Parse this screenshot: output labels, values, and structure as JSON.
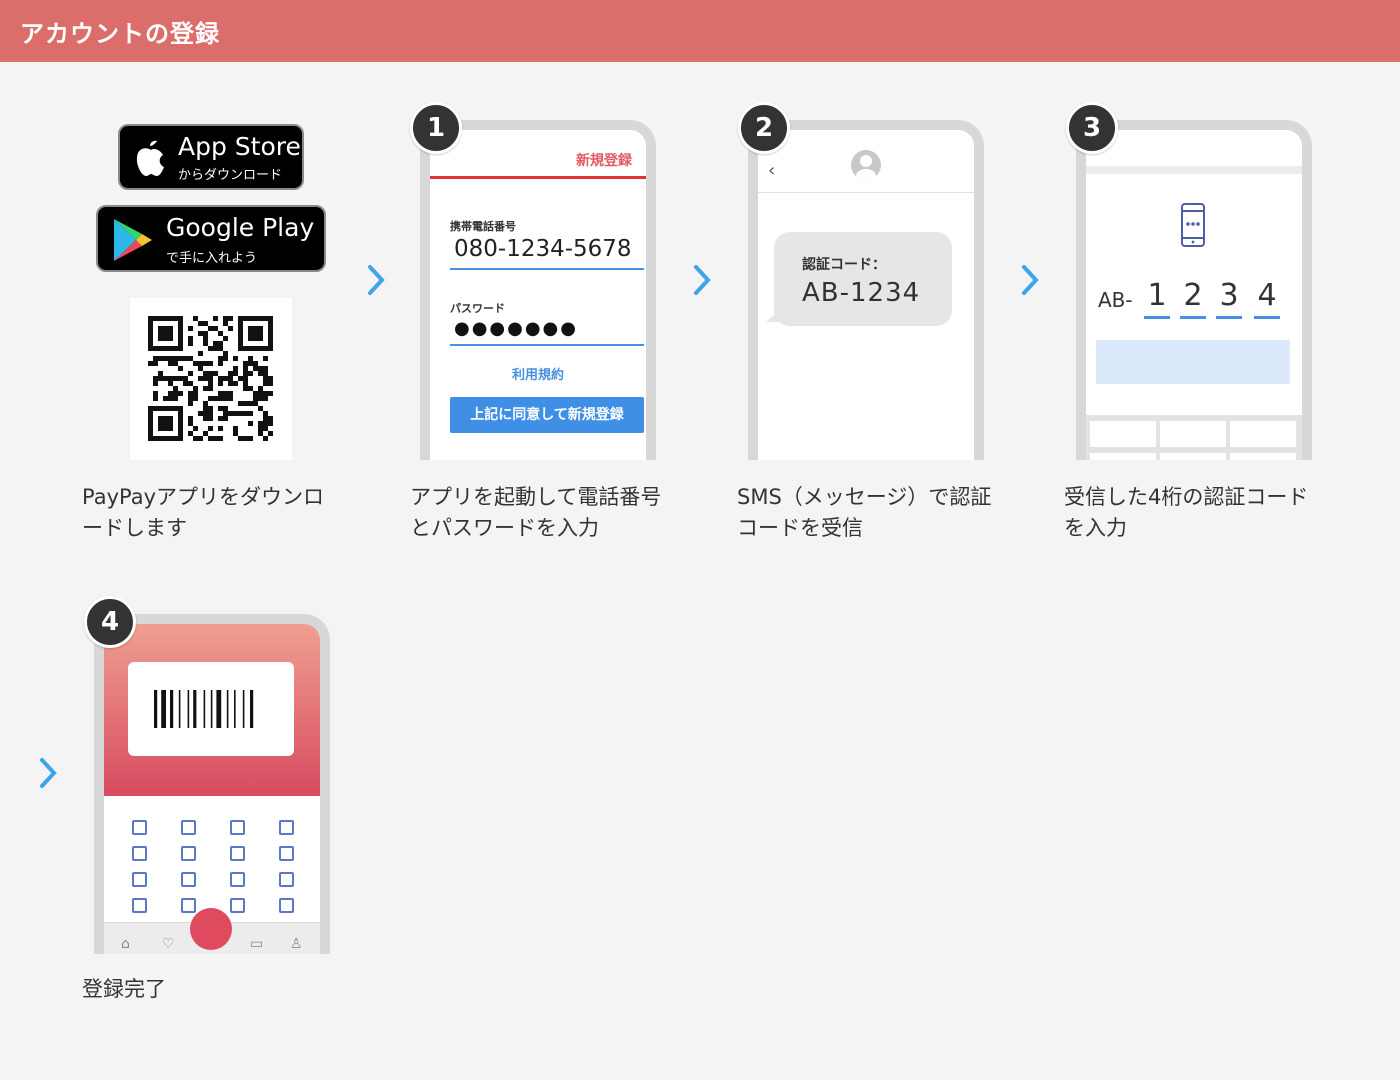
{
  "header": {
    "title": "アカウントの登録"
  },
  "store": {
    "appstore_big": "App Store",
    "appstore_small": "からダウンロード",
    "google_big": "Google Play",
    "google_small": "で手に入れよう"
  },
  "steps": [
    {
      "caption": "PayPayアプリをダウンロードします"
    },
    {
      "number": "1",
      "caption": "アプリを起動して電話番号とパスワードを入力"
    },
    {
      "number": "2",
      "caption": "SMS（メッセージ）で認証コードを受信"
    },
    {
      "number": "3",
      "caption": "受信した4桁の認証コードを入力"
    },
    {
      "number": "4",
      "caption": "登録完了"
    }
  ],
  "phone1": {
    "top_link": "新規登録",
    "phone_label": "携帯電話番号",
    "phone_value": "080-1234-5678",
    "password_label": "パスワード",
    "password_value": "●●●●●●●",
    "terms": "利用規約",
    "submit": "上記に同意して新規登録"
  },
  "phone2": {
    "back": "‹",
    "code_label": "認証コード：",
    "code_value": "AB-1234"
  },
  "phone3": {
    "prefix": "AB-",
    "digits": [
      "1",
      "2",
      "3",
      "4"
    ]
  },
  "colors": {
    "header": "#db6e6a",
    "accent_blue": "#4a90e2",
    "accent_red": "#e0303a"
  }
}
